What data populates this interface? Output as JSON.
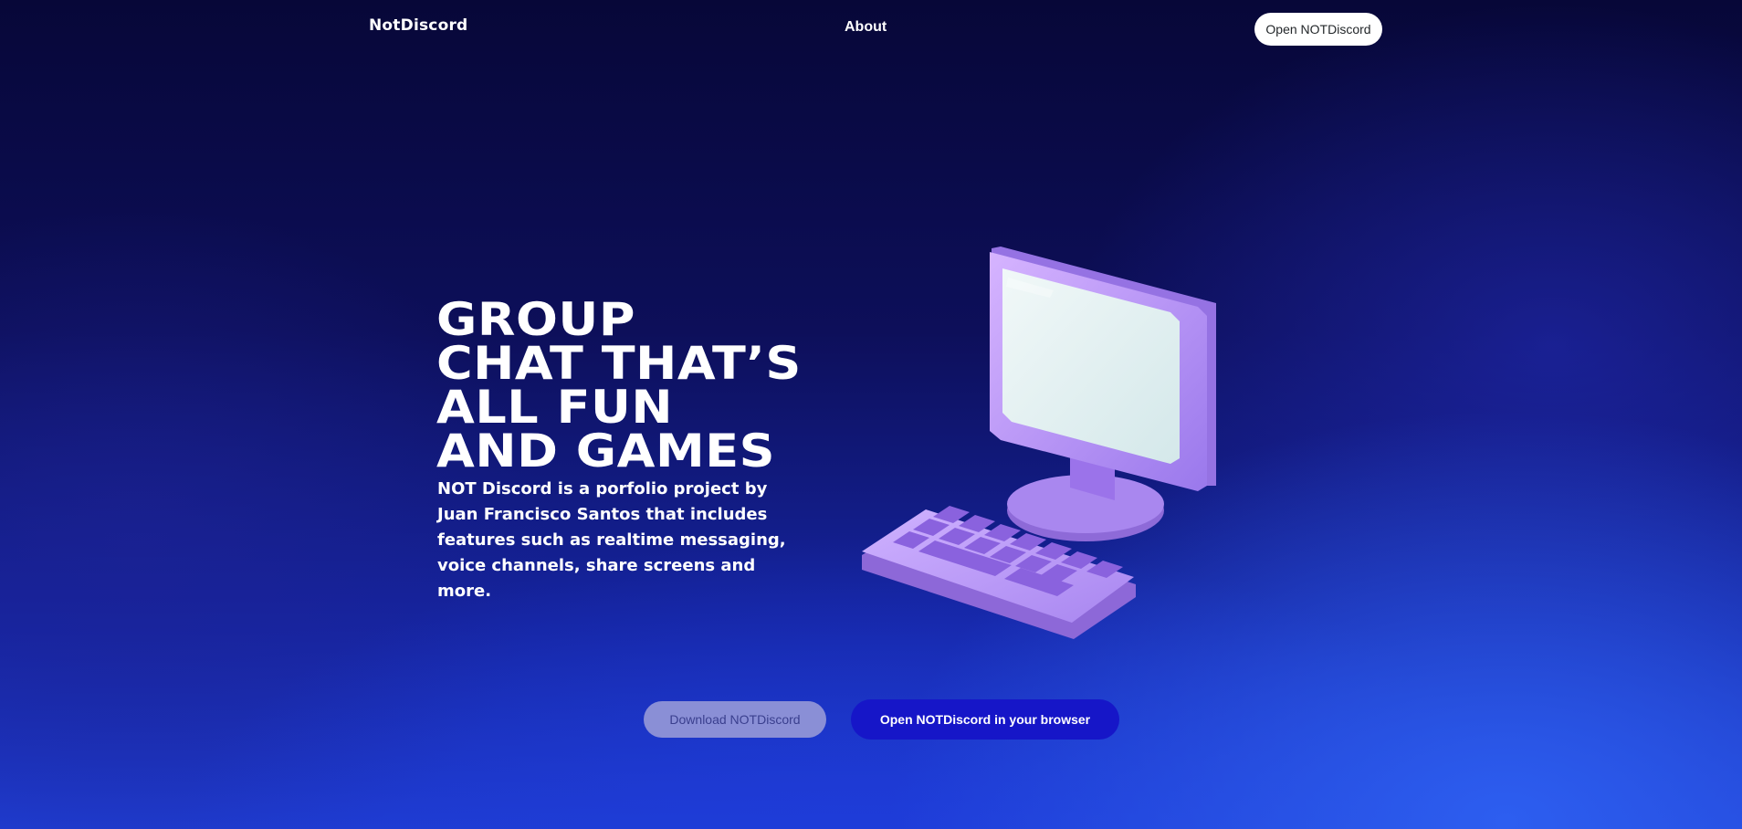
{
  "nav": {
    "logo": "NotDiscord",
    "about_label": "About",
    "open_label": "Open NOTDiscord"
  },
  "hero": {
    "title_lines": [
      "GROUP",
      "CHAT THAT’S",
      "ALL FUN",
      "AND GAMES"
    ],
    "description": "NOT Discord is a porfolio project by Juan Francisco Santos that includes features such as realtime messaging, voice channels, share screens and more.",
    "illustration": "computer-keyboard-illustration"
  },
  "actions": {
    "download_label": "Download NOTDiscord",
    "browser_label": "Open NOTDiscord in your browser"
  },
  "colors": {
    "background_dark": "#070738",
    "background_bright": "#2d5ef0",
    "download_button": "#8a8fd6",
    "browser_button": "#1616c8",
    "illustration_purple": "#b58cf5"
  }
}
